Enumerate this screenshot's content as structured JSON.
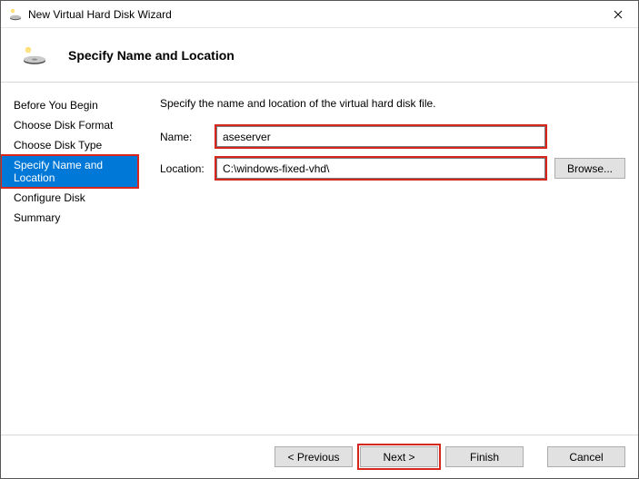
{
  "window": {
    "title": "New Virtual Hard Disk Wizard"
  },
  "header": {
    "heading": "Specify Name and Location"
  },
  "sidebar": {
    "items": [
      {
        "label": "Before You Begin"
      },
      {
        "label": "Choose Disk Format"
      },
      {
        "label": "Choose Disk Type"
      },
      {
        "label": "Specify Name and Location"
      },
      {
        "label": "Configure Disk"
      },
      {
        "label": "Summary"
      }
    ],
    "active_index": 3
  },
  "main": {
    "instruction": "Specify the name and location of the virtual hard disk file.",
    "name_label": "Name:",
    "name_value": "aseserver",
    "location_label": "Location:",
    "location_value": "C:\\windows-fixed-vhd\\",
    "browse_label": "Browse..."
  },
  "footer": {
    "previous": "< Previous",
    "next": "Next >",
    "finish": "Finish",
    "cancel": "Cancel"
  },
  "colors": {
    "selection": "#0078d7",
    "highlight": "#d9261c"
  }
}
